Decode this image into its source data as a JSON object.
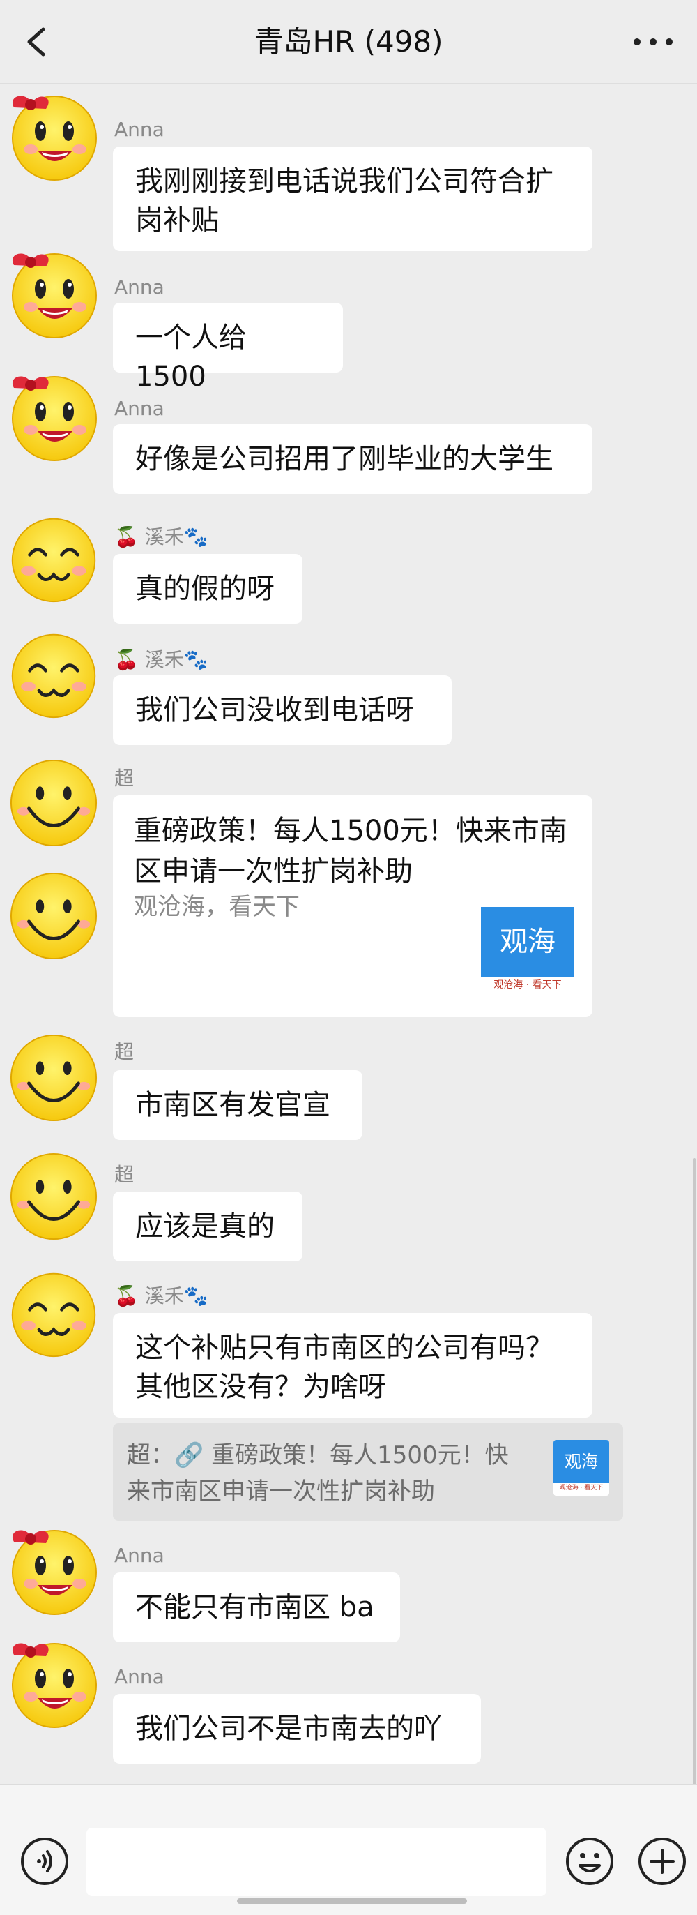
{
  "header": {
    "title": "青岛HR (498)",
    "back_icon": "chevron-left-icon",
    "more_icon": "more-dots-icon"
  },
  "messages": [
    {
      "sender": "Anna",
      "text": "我刚刚接到电话说我们公司符合扩\n岗补贴",
      "avatar": "girl-bow-avatar"
    },
    {
      "sender": "Anna",
      "text": "一个人给 1500",
      "avatar": "girl-bow-avatar"
    },
    {
      "sender": "Anna",
      "text": "好像是公司招用了刚毕业的大学生",
      "avatar": "girl-bow-avatar"
    },
    {
      "sender": "🍒 溪禾🐾",
      "text": "真的假的呀",
      "avatar": "happy-squint-avatar"
    },
    {
      "sender": "🍒 溪禾🐾",
      "text": "我们公司没收到电话呀",
      "avatar": "happy-squint-avatar"
    },
    {
      "sender": "超",
      "avatar": "smiley-avatar",
      "card": {
        "title": "重磅政策！每人1500元！快来市南区申请一次性扩岗补助",
        "source": "观沧海，看天下",
        "logo_text": "观海",
        "logo_tag": "观沧海 · 看天下"
      }
    },
    {
      "sender": "超",
      "text": "市南区有发官宣",
      "avatar": "smiley-avatar"
    },
    {
      "sender": "超",
      "text": "应该是真的",
      "avatar": "smiley-avatar"
    },
    {
      "sender": "🍒 溪禾🐾",
      "text": "这个补贴只有市南区的公司有吗？\n其他区没有？为啥呀",
      "avatar": "happy-squint-avatar",
      "quote": {
        "text": "超：🔗 重磅政策！每人1500元！快来市南区申请一次性扩岗补助",
        "logo_text": "观海",
        "logo_tag": "观沧海 · 看天下"
      }
    },
    {
      "sender": "Anna",
      "text": "不能只有市南区 ba",
      "avatar": "girl-bow-avatar"
    },
    {
      "sender": "Anna",
      "text": "我们公司不是市南去的吖",
      "avatar": "girl-bow-avatar"
    }
  ],
  "input_bar": {
    "voice_icon": "voice-icon",
    "input_value": "",
    "emoji_icon": "emoji-icon",
    "plus_icon": "plus-icon"
  },
  "colors": {
    "background": "#ededed",
    "bubble": "#ffffff",
    "sender_text": "#8a8a8a",
    "logo_blue": "#2a8de3"
  }
}
